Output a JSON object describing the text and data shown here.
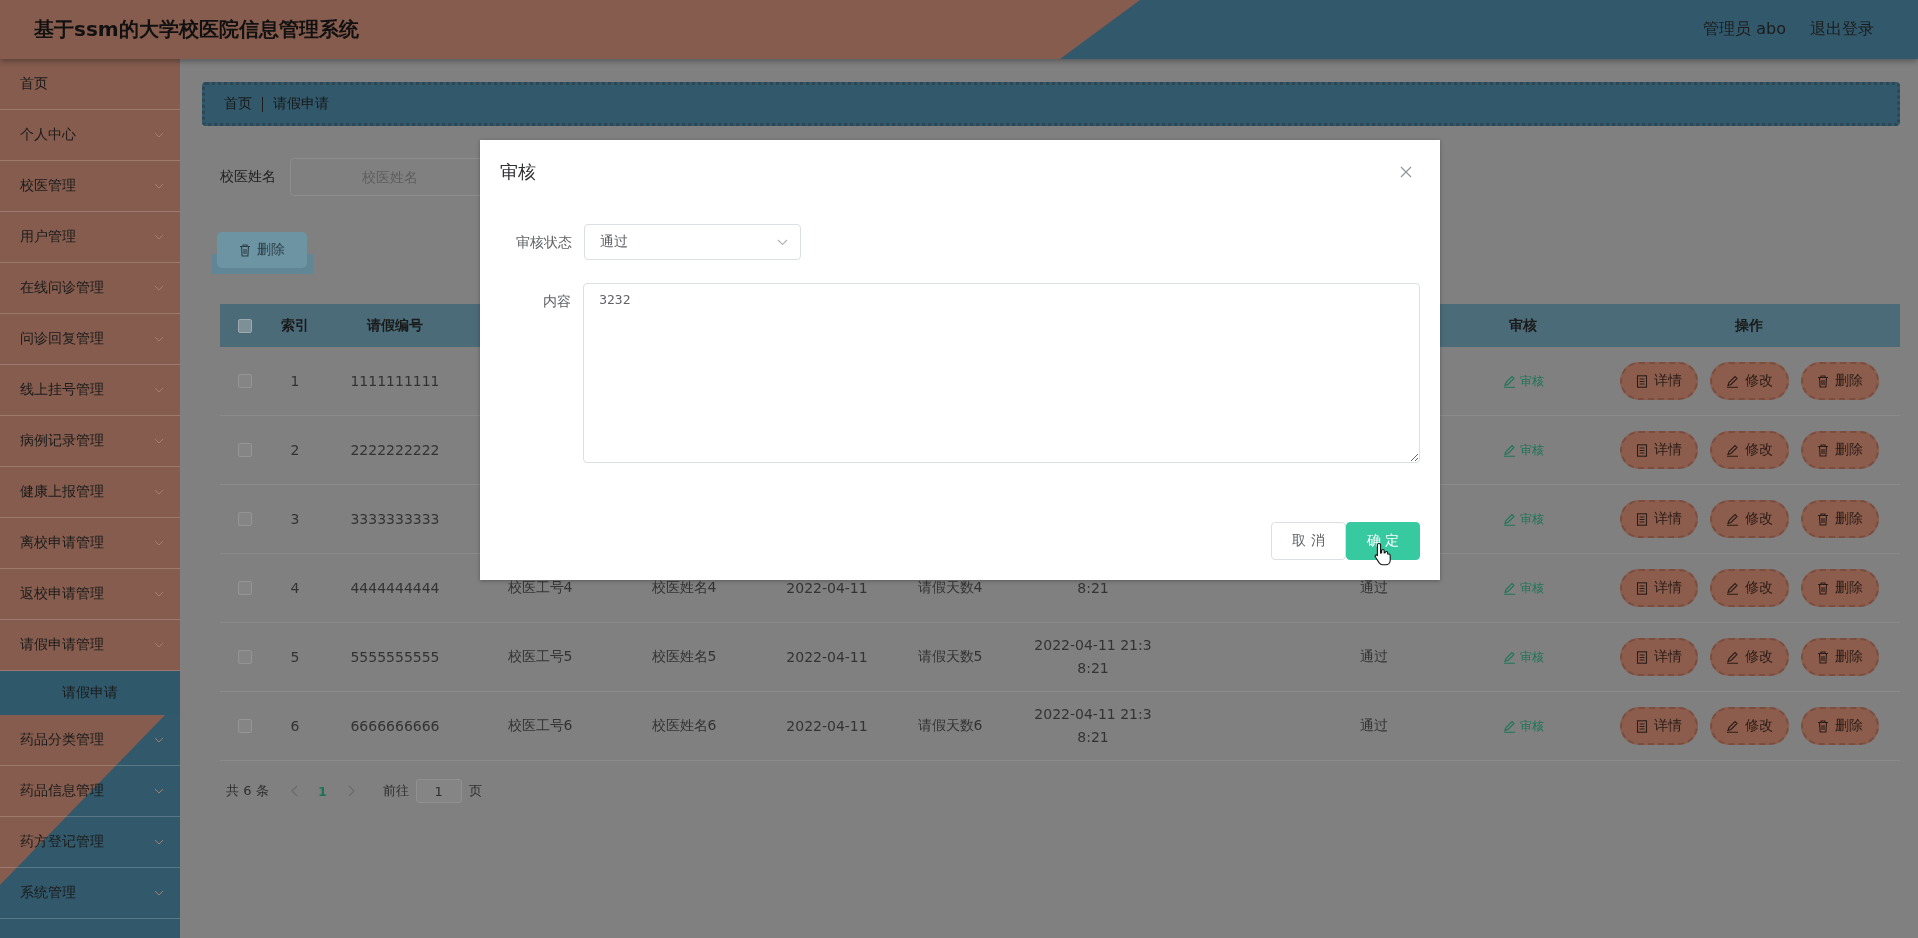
{
  "header": {
    "title": "基于ssm的大学校医院信息管理系统",
    "user": "管理员 abo",
    "logout": "退出登录"
  },
  "sidebar": {
    "items": [
      {
        "label": "首页",
        "expandable": false
      },
      {
        "label": "个人中心",
        "expandable": true
      },
      {
        "label": "校医管理",
        "expandable": true
      },
      {
        "label": "用户管理",
        "expandable": true
      },
      {
        "label": "在线问诊管理",
        "expandable": true
      },
      {
        "label": "问诊回复管理",
        "expandable": true
      },
      {
        "label": "线上挂号管理",
        "expandable": true
      },
      {
        "label": "病例记录管理",
        "expandable": true
      },
      {
        "label": "健康上报管理",
        "expandable": true
      },
      {
        "label": "离校申请管理",
        "expandable": true
      },
      {
        "label": "返校申请管理",
        "expandable": true
      },
      {
        "label": "请假申请管理",
        "expandable": true,
        "children": [
          {
            "label": "请假申请",
            "selected": true
          }
        ]
      },
      {
        "label": "药品分类管理",
        "expandable": true
      },
      {
        "label": "药品信息管理",
        "expandable": true
      },
      {
        "label": "药方登记管理",
        "expandable": true
      },
      {
        "label": "系统管理",
        "expandable": true
      }
    ]
  },
  "breadcrumb": [
    "首页",
    "请假申请"
  ],
  "search": {
    "label": "校医姓名",
    "placeholder": "校医姓名"
  },
  "delete_button": "删除",
  "table": {
    "select_all": {
      "checked": false
    },
    "header": {
      "index": "索引",
      "number": "请假编号",
      "review": "审核",
      "actions": "操作"
    },
    "rows": [
      {
        "checked": false,
        "index": "1",
        "number": "1111111111",
        "review": "审核",
        "actions": [
          {
            "kind": "detail",
            "label": "详情"
          },
          {
            "kind": "edit",
            "label": "修改"
          },
          {
            "kind": "delete",
            "label": "删除"
          }
        ]
      },
      {
        "checked": false,
        "index": "2",
        "number": "2222222222",
        "review": "审核",
        "actions": [
          {
            "kind": "detail",
            "label": "详情"
          },
          {
            "kind": "edit",
            "label": "修改"
          },
          {
            "kind": "delete",
            "label": "删除"
          }
        ]
      },
      {
        "checked": false,
        "index": "3",
        "number": "3333333333",
        "review": "审核",
        "actions": [
          {
            "kind": "detail",
            "label": "详情"
          },
          {
            "kind": "edit",
            "label": "修改"
          },
          {
            "kind": "delete",
            "label": "删除"
          }
        ]
      },
      {
        "checked": false,
        "index": "4",
        "number": "4444444444",
        "staff_id": "校医工号4",
        "staff_name": "校医姓名4",
        "date": "2022-04-11",
        "days": "请假天数4",
        "datetime": "8:21",
        "status": "通过",
        "review": "审核",
        "actions": [
          {
            "kind": "detail",
            "label": "详情"
          },
          {
            "kind": "edit",
            "label": "修改"
          },
          {
            "kind": "delete",
            "label": "删除"
          }
        ]
      },
      {
        "checked": false,
        "index": "5",
        "number": "5555555555",
        "staff_id": "校医工号5",
        "staff_name": "校医姓名5",
        "date": "2022-04-11",
        "days": "请假天数5",
        "datetime": "2022-04-11 21:38:21",
        "status": "通过",
        "review": "审核",
        "actions": [
          {
            "kind": "detail",
            "label": "详情"
          },
          {
            "kind": "edit",
            "label": "修改"
          },
          {
            "kind": "delete",
            "label": "删除"
          }
        ]
      },
      {
        "checked": false,
        "index": "6",
        "number": "6666666666",
        "staff_id": "校医工号6",
        "staff_name": "校医姓名6",
        "date": "2022-04-11",
        "days": "请假天数6",
        "datetime": "2022-04-11 21:38:21",
        "status": "通过",
        "review": "审核",
        "actions": [
          {
            "kind": "detail",
            "label": "详情"
          },
          {
            "kind": "edit",
            "label": "修改"
          },
          {
            "kind": "delete",
            "label": "删除"
          }
        ]
      }
    ]
  },
  "pagination": {
    "total": "共 6 条",
    "pages": [
      {
        "label": "1",
        "selected": true
      }
    ],
    "goto_label": "前往",
    "goto_value": "1",
    "page_suffix": "页"
  },
  "dialog": {
    "title": "审核",
    "fields": [
      {
        "kind": "select",
        "label": "审核状态",
        "value": "通过"
      },
      {
        "kind": "textarea",
        "label": "内容",
        "value": "3232"
      }
    ],
    "buttons": [
      {
        "kind": "secondary",
        "label": "取 消"
      },
      {
        "kind": "primary",
        "label": "确 定"
      }
    ]
  }
}
